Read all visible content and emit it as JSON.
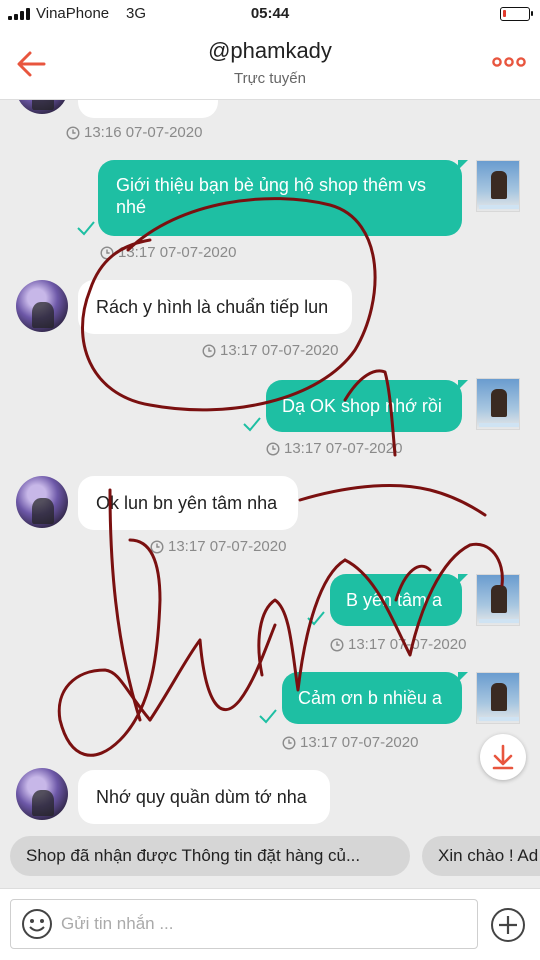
{
  "status": {
    "carrier": "VinaPhone",
    "network": "3G",
    "time": "05:44",
    "battery_level": 0.12
  },
  "header": {
    "title": "@phamkady",
    "subtitle": "Trực tuyến"
  },
  "messages": [
    {
      "from": "contact",
      "text": "",
      "time": "13:16 07-07-2020"
    },
    {
      "from": "me",
      "text": "Giới thiệu bạn bè ủng hộ shop thêm vs nhé",
      "time": "13:17 07-07-2020",
      "read": true
    },
    {
      "from": "contact",
      "text": "Rách y hình là chuẩn tiếp lun",
      "time": "13:17 07-07-2020"
    },
    {
      "from": "me",
      "text": "Dạ OK shop nhớ rồi",
      "time": "13:17 07-07-2020",
      "read": true
    },
    {
      "from": "contact",
      "text": "Ok lun bn yên tâm nha",
      "time": "13:17 07-07-2020"
    },
    {
      "from": "me",
      "text": "B yên tâm a",
      "time": "13:17 07-07-2020",
      "read": true
    },
    {
      "from": "me",
      "text": "Cảm ơn b nhiều a",
      "time": "13:17 07-07-2020",
      "read": true
    },
    {
      "from": "contact",
      "text": "Nhớ quy quần dùm tớ nha",
      "time": ""
    }
  ],
  "quick_replies": [
    "Shop đã nhận được Thông tin đặt hàng củ...",
    "Xin chào ! Ad"
  ],
  "composer": {
    "placeholder": "Gửi tin nhắn ..."
  },
  "colors": {
    "accent": "#e8553e",
    "out_bubble": "#1ebfa3",
    "in_bubble": "#ffffff",
    "chat_bg": "#ececec",
    "ink": "#7a1010"
  },
  "icons": [
    "back-arrow-icon",
    "more-dots-icon",
    "clock-icon",
    "check-icon",
    "download-arrow-icon",
    "emoji-icon",
    "plus-circle-icon"
  ]
}
